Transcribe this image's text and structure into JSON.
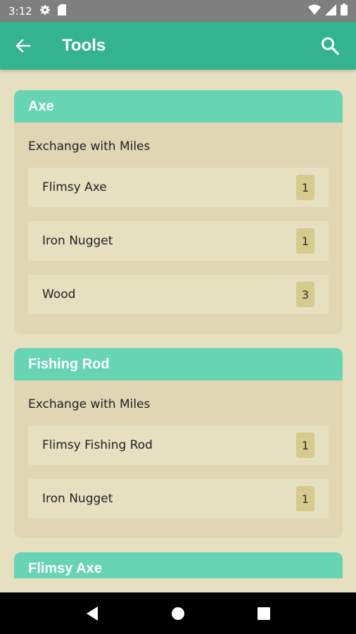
{
  "status_bar": {
    "time": "3:12",
    "icons": [
      "gear-icon",
      "sd-card-icon",
      "wifi-icon",
      "signal-icon",
      "battery-icon"
    ]
  },
  "app_bar": {
    "title": "Tools",
    "back_icon": "arrow-back-icon",
    "search_icon": "search-icon"
  },
  "colors": {
    "status_bar": "#7f7f7f",
    "app_bar": "#33b48f",
    "card_header": "#67d4b4",
    "background": "#e6dfc0",
    "card": "#e0d6b4",
    "qty_badge": "#d5cb8c"
  },
  "cards": [
    {
      "title": "Axe",
      "subtitle": "Exchange with Miles",
      "items": [
        {
          "name": "Flimsy Axe",
          "qty": "1"
        },
        {
          "name": "Iron Nugget",
          "qty": "1"
        },
        {
          "name": "Wood",
          "qty": "3"
        }
      ]
    },
    {
      "title": "Fishing Rod",
      "subtitle": "Exchange with Miles",
      "items": [
        {
          "name": "Flimsy Fishing Rod",
          "qty": "1"
        },
        {
          "name": "Iron Nugget",
          "qty": "1"
        }
      ]
    },
    {
      "title": "Flimsy Axe",
      "subtitle": "",
      "items": []
    }
  ],
  "nav_bar": {
    "icons": [
      "back-triangle-icon",
      "home-circle-icon",
      "recents-square-icon"
    ]
  }
}
